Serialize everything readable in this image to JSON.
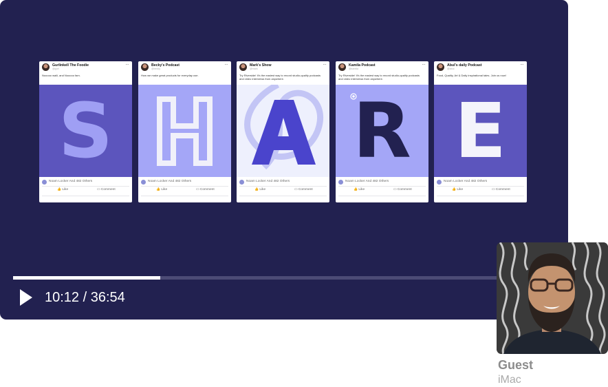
{
  "player": {
    "time_display": "10:12 / 36:54",
    "progress": 0.2655,
    "colors": {
      "background": "#222150",
      "track": "#4c4b75",
      "fill": "#ffffff"
    },
    "play_icon": "play-icon"
  },
  "slide": {
    "cards": [
      {
        "author": "Gurlinkell The Foodie",
        "handle": "@gurl",
        "text": "Nooooo waiii, and Nooooo fam.",
        "letter": "S",
        "art_bg": "#5c55bd",
        "letter_color": "#9f9ff4",
        "reactions": "Noam Locker And 482 Others",
        "like": "Like",
        "comment": "Comment"
      },
      {
        "author": "Becky's Podcast",
        "handle": "@becky",
        "text": "How we make great products for everyday use.",
        "letter": "H",
        "art_bg": "#a4a6f7",
        "letter_color": "#f0f0fa",
        "reactions": "Noam Locker And 482 Others",
        "like": "Like",
        "comment": "Comment"
      },
      {
        "author": "Mark's Show",
        "handle": "@mark",
        "text": "Try Riverside! It's the easiest way to record studio-quality podcasts and video interviews from anywhere.",
        "letter": "A",
        "art_bg": "#eef0fd",
        "letter_color": "#4a44cc",
        "reactions": "Noam Locker And 482 Others",
        "like": "Like",
        "comment": "Comment"
      },
      {
        "author": "Kamila Podcast",
        "handle": "@kamila",
        "text": "Try Riverside! It's the easiest way to record studio-quality podcasts and video interviews from anywhere.",
        "letter": "R",
        "art_bg": "#a4a6f7",
        "letter_color": "#222150",
        "reactions": "Noam Locker And 482 Others",
        "like": "Like",
        "comment": "Comment"
      },
      {
        "author": "Abul's daily Podcast",
        "handle": "@abul",
        "text": "Food, Quality, Art & Daily inspirational tales. Join us now!",
        "letter": "E",
        "art_bg": "#5c55bd",
        "letter_color": "#f4f4fb",
        "reactions": "Noam Locker And 482 Others",
        "like": "Like",
        "comment": "Comment"
      }
    ]
  },
  "guest": {
    "name": "Guest",
    "device": "iMac"
  }
}
